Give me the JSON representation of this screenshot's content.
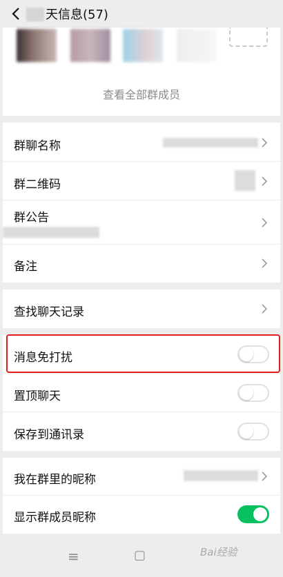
{
  "header": {
    "title": "天信息(57)"
  },
  "members": {
    "view_all": "查看全部群成员",
    "avatar_colors": [
      "#6e5a58",
      "#b8a4ac",
      "#a8d4e0",
      "#e6e6e6"
    ]
  },
  "group1": {
    "group_name": "群聊名称",
    "qr_code": "群二维码",
    "announcement": "群公告",
    "remark": "备注"
  },
  "group2": {
    "search_history": "查找聊天记录"
  },
  "group3": {
    "mute": {
      "label": "消息免打扰",
      "on": false
    },
    "pin": {
      "label": "置顶聊天",
      "on": false
    },
    "save_contacts": {
      "label": "保存到通讯录",
      "on": false
    }
  },
  "group4": {
    "my_nickname": "我在群里的昵称",
    "show_nicknames": {
      "label": "显示群成员昵称",
      "on": true
    }
  },
  "colors": {
    "accent": "#07c160",
    "highlight": "#e02020"
  },
  "navbar": {
    "menu_icon": "≡",
    "home_icon": "▢",
    "watermark": "Bai经验"
  }
}
